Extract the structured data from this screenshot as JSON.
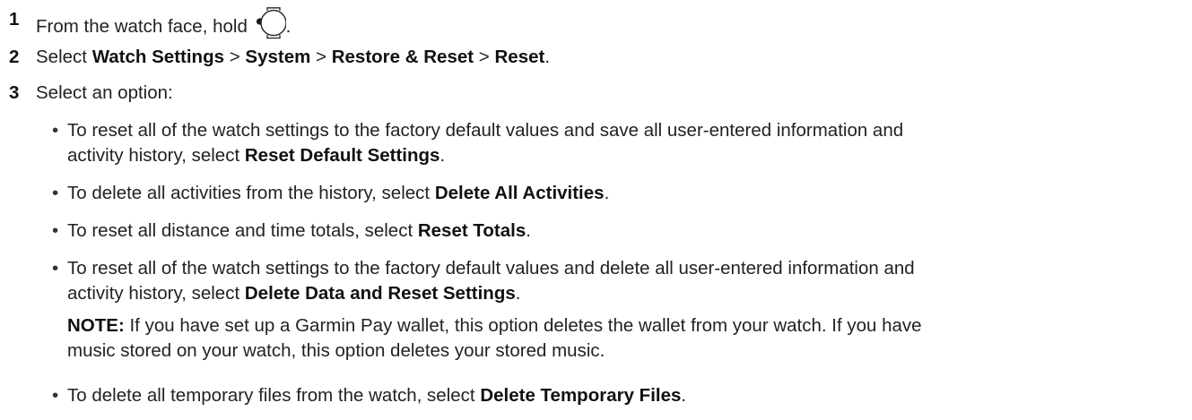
{
  "steps": [
    {
      "number": "1",
      "text": "From the watch face, hold",
      "icon": "watch-button-icon",
      "text_after": "."
    },
    {
      "number": "2",
      "prefix": "Select",
      "path": [
        "Watch Settings",
        "System",
        "Restore & Reset",
        "Reset"
      ],
      "separator": ">",
      "suffix": "."
    },
    {
      "number": "3",
      "text": "Select an option:"
    }
  ],
  "options": [
    {
      "text_line1": "To reset all of the watch settings to the factory default values and save all user-entered information and",
      "text_line2": "activity history, select",
      "bold": "Reset Default Settings",
      "end": "."
    },
    {
      "text": "To delete all activities from the history, select",
      "bold": "Delete All Activities",
      "end": "."
    },
    {
      "text": "To reset all distance and time totals, select",
      "bold": "Reset Totals",
      "end": "."
    },
    {
      "text_line1": "To reset all of the watch settings to the factory default values and delete all user-entered information and",
      "text_line2": "activity history, select",
      "bold": "Delete Data and Reset Settings",
      "end": "."
    },
    {
      "text": "To delete all temporary files from the watch, select",
      "bold": "Delete Temporary Files",
      "end": "."
    }
  ],
  "note": {
    "label": "NOTE:",
    "line1": "If you have set up a Garmin Pay wallet, this option deletes the wallet from your watch. If you have",
    "line2": "music stored on your watch, this option deletes your stored music."
  },
  "bullet_char": "•"
}
